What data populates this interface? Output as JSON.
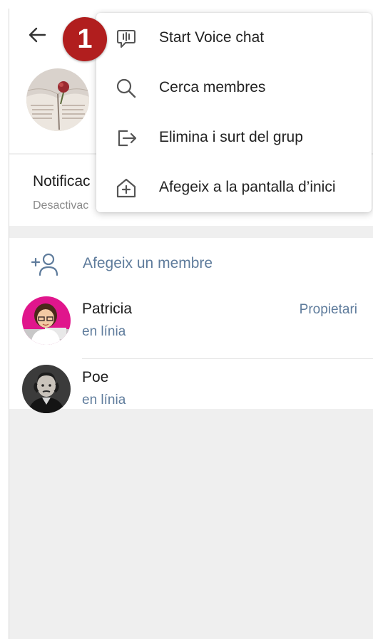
{
  "menu": {
    "items": [
      {
        "label": "Start Voice chat",
        "icon": "voice-chat-icon"
      },
      {
        "label": "Cerca membres",
        "icon": "search-icon"
      },
      {
        "label": "Elimina i surt del grup",
        "icon": "leave-group-icon"
      },
      {
        "label": "Afegeix a la pantalla d’inici",
        "icon": "add-to-home-icon"
      }
    ]
  },
  "badge": {
    "text": "1",
    "color": "#b11e1e"
  },
  "notifications": {
    "title": "Notificac",
    "subtitle": "Desactivac"
  },
  "add_member": {
    "label": "Afegeix un membre",
    "icon": "add-user-icon"
  },
  "members": [
    {
      "name": "Patricia",
      "status": "en línia",
      "role": "Propietari"
    },
    {
      "name": "Poe",
      "status": "en línia",
      "role": ""
    }
  ],
  "colors": {
    "accent": "#5f7c9c",
    "background": "#efefef",
    "badge": "#b11e1e"
  }
}
